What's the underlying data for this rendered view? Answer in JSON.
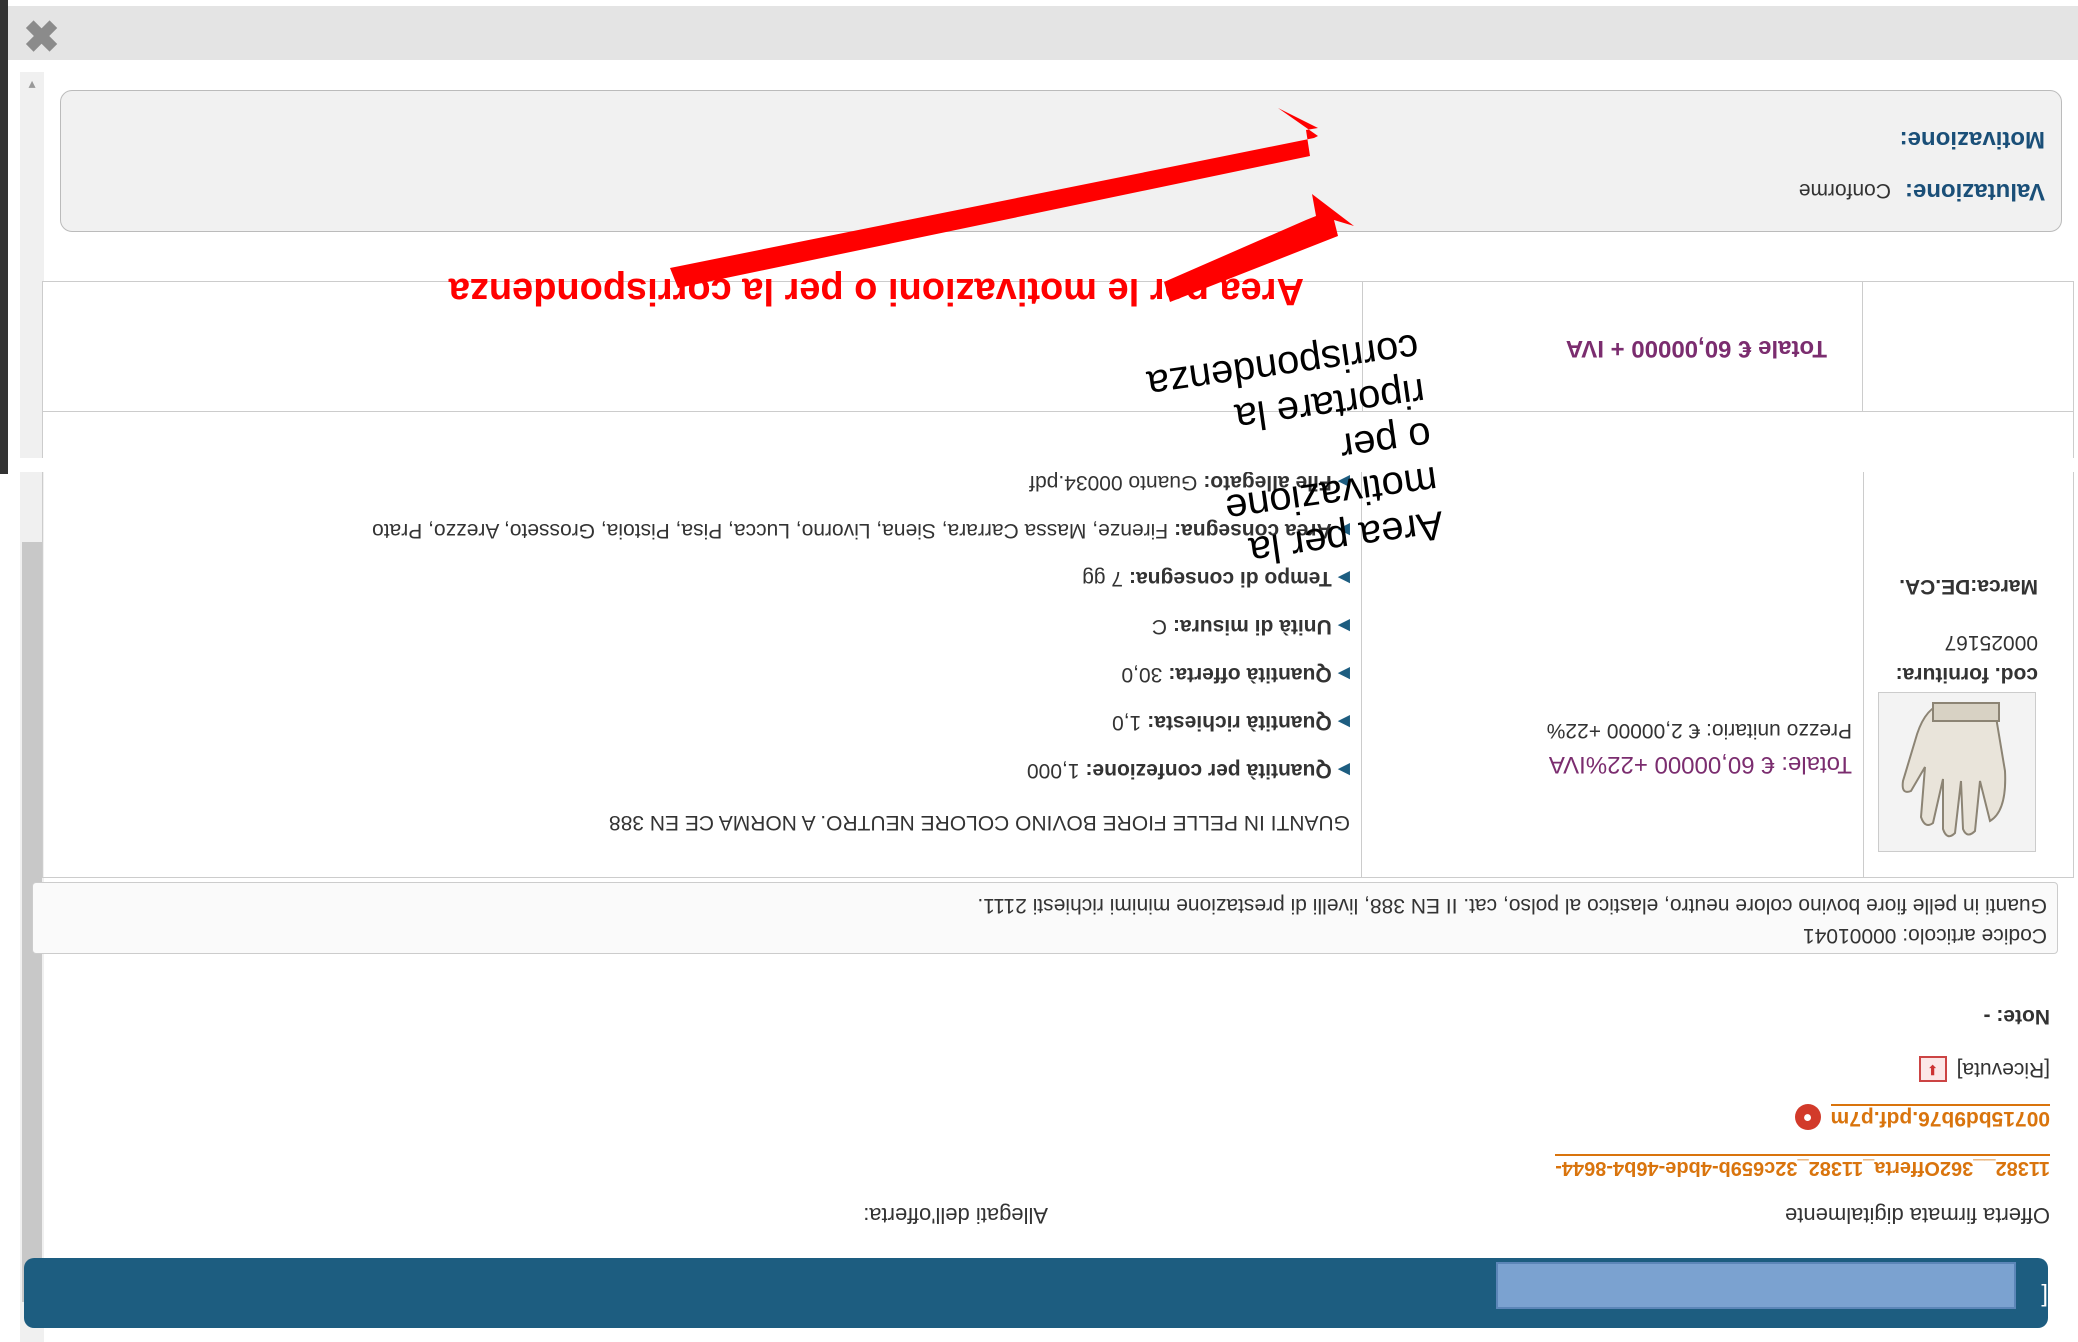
{
  "dialog": {
    "close_label": "✖",
    "valutazione_label": "Valutazione:",
    "valutazione_value": "Conforme",
    "motivazione_label": "Motivazione:"
  },
  "totals": {
    "total_label": "Totale € 60,00000 + IVA"
  },
  "product": {
    "marca": "Marca:DE.CA.",
    "cod_fornitura_label": "cod. fornitura:",
    "cod_fornitura_value": "00025167",
    "unit_price": "Prezzo unitario: € 2,00000 +22%",
    "row_total": "Totale: € 60,00000 +22%IVA",
    "title": "GUANTI IN PELLE FIORE BOVINO COLORE NEUTRO. A NORMA CE EN 388",
    "details": [
      {
        "label": "Quantità per confezione:",
        "value": "1,000"
      },
      {
        "label": "Quantità richiesta:",
        "value": "1,0"
      },
      {
        "label": "Quantità offerta:",
        "value": "30,0"
      },
      {
        "label": "Unità di misura:",
        "value": "C"
      },
      {
        "label": "Tempo di consegna:",
        "value": "7 gg"
      },
      {
        "label": "Area consegna:",
        "value": "Firenze, Massa Carrara, Siena, Livorno, Lucca, Pisa, Pistoia, Grosseto, Arezzo, Prato"
      },
      {
        "label": "File allegato:",
        "value": "Guanto 00034.pdf"
      }
    ],
    "codice_articolo": "Codice articolo: 00001041",
    "description": "Guanti in pelle fiore bovino colore neutro, elastico al polso, cat. II EN 388, livelli di prestazione minimi richiesti 2111."
  },
  "offer": {
    "note": "Note: -",
    "ricevuta": "[Ricevuta]",
    "file_p7m": "00715bd9b76.pdf.p7m",
    "file_link": "11382__362Offerta_11382_32c659b-4bde-46b4-8644-",
    "offerta_firmata": "Offerta firmata digitalmente",
    "allegati": "Allegati dell'offerta:"
  },
  "band": {
    "bracket": "["
  },
  "annotations": {
    "red_text": "Area per le motivazioni o per la corrispondenza",
    "black_text": "Area per la motivazione o per riportare la corrispondenza",
    "arrow_color": "#ff0000"
  }
}
